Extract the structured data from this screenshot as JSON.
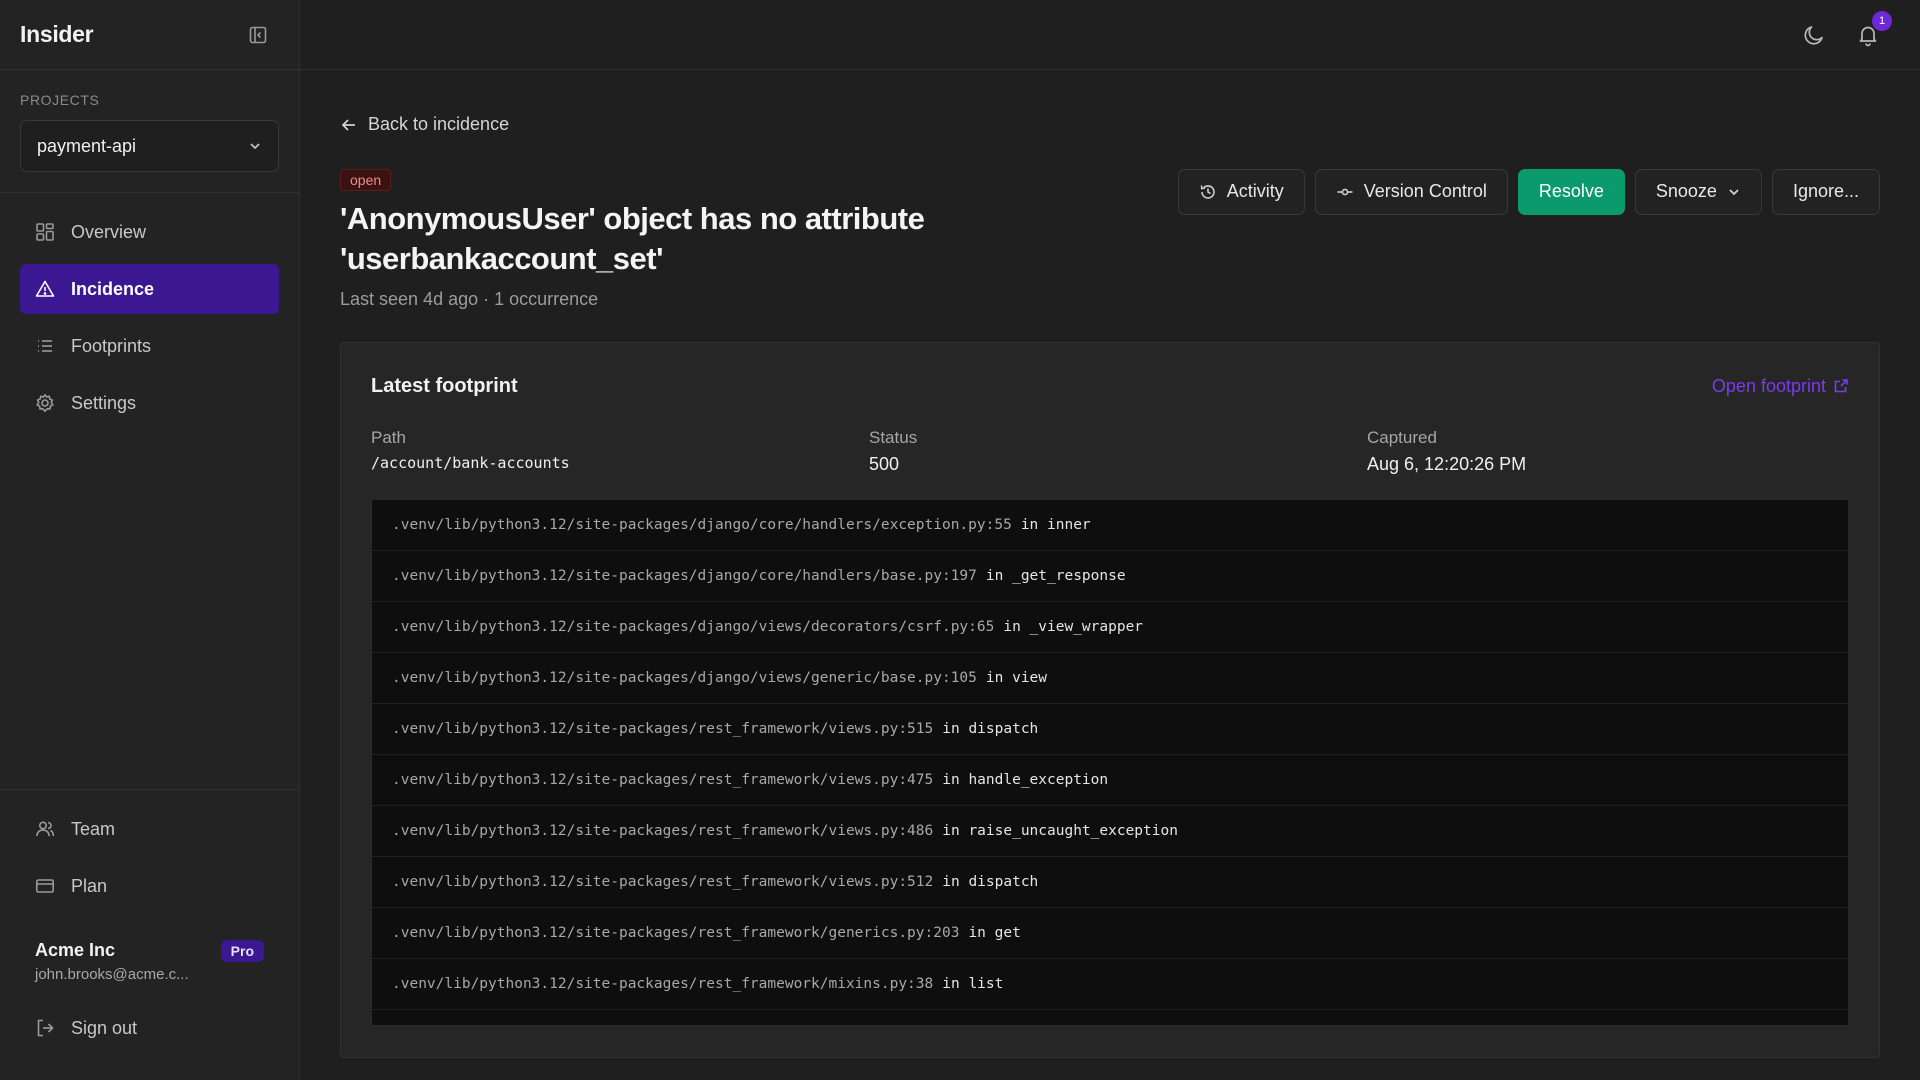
{
  "app": {
    "name": "Insider"
  },
  "sidebar": {
    "projects_label": "PROJECTS",
    "selected_project": "payment-api",
    "nav": [
      {
        "label": "Overview",
        "icon": "grid-icon",
        "active": false
      },
      {
        "label": "Incidence",
        "icon": "warning-triangle-icon",
        "active": true
      },
      {
        "label": "Footprints",
        "icon": "list-icon",
        "active": false
      },
      {
        "label": "Settings",
        "icon": "gear-icon",
        "active": false
      }
    ],
    "bottom": [
      {
        "label": "Team",
        "icon": "users-icon"
      },
      {
        "label": "Plan",
        "icon": "credit-card-icon"
      }
    ],
    "account": {
      "name": "Acme Inc",
      "email": "john.brooks@acme.c...",
      "badge": "Pro"
    },
    "sign_out": "Sign out"
  },
  "topbar": {
    "notification_count": "1"
  },
  "page": {
    "back_label": "Back to incidence",
    "status": "open",
    "title": "'AnonymousUser' object has no attribute 'userbankaccount_set'",
    "subtitle": "Last seen 4d ago · 1 occurrence",
    "actions": {
      "activity": "Activity",
      "version_control": "Version Control",
      "resolve": "Resolve",
      "snooze": "Snooze",
      "ignore": "Ignore..."
    }
  },
  "footprint": {
    "title": "Latest footprint",
    "open_link": "Open footprint",
    "path_label": "Path",
    "path": "/account/bank-accounts",
    "status_label": "Status",
    "status": "500",
    "captured_label": "Captured",
    "captured": "Aug 6, 12:20:26 PM",
    "frames": [
      {
        "file": ".venv/lib/python3.12/site-packages/django/core/handlers/exception.py:55",
        "fn": "in inner"
      },
      {
        "file": ".venv/lib/python3.12/site-packages/django/core/handlers/base.py:197",
        "fn": "in _get_response"
      },
      {
        "file": ".venv/lib/python3.12/site-packages/django/views/decorators/csrf.py:65",
        "fn": "in _view_wrapper"
      },
      {
        "file": ".venv/lib/python3.12/site-packages/django/views/generic/base.py:105",
        "fn": "in view"
      },
      {
        "file": ".venv/lib/python3.12/site-packages/rest_framework/views.py:515",
        "fn": "in dispatch"
      },
      {
        "file": ".venv/lib/python3.12/site-packages/rest_framework/views.py:475",
        "fn": "in handle_exception"
      },
      {
        "file": ".venv/lib/python3.12/site-packages/rest_framework/views.py:486",
        "fn": "in raise_uncaught_exception"
      },
      {
        "file": ".venv/lib/python3.12/site-packages/rest_framework/views.py:512",
        "fn": "in dispatch"
      },
      {
        "file": ".venv/lib/python3.12/site-packages/rest_framework/generics.py:203",
        "fn": "in get"
      },
      {
        "file": ".venv/lib/python3.12/site-packages/rest_framework/mixins.py:38",
        "fn": "in list"
      }
    ]
  },
  "colors": {
    "accent": "#3b1791",
    "success": "#0b9a6b",
    "link": "#7c3aed",
    "danger": "#f08a8a"
  }
}
